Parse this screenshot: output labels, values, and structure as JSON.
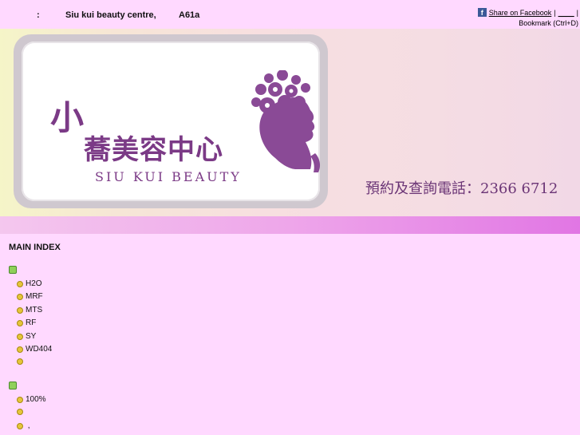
{
  "topbar": {
    "colon": ":",
    "business_name": "Siu kui beauty centre,",
    "code": "A61a",
    "facebook_icon": "f",
    "share_label": "Share on Facebook",
    "separator": "|",
    "blank_link": "____",
    "separator2": "|",
    "bookmark": "Bookmark (Ctrl+D)"
  },
  "banner": {
    "logo_cn_small": "小",
    "logo_cn_main": "蕎美容中心",
    "logo_en": "SIU KUI BEAUTY",
    "phone": "預約及查詢電話：2366 6712"
  },
  "nav": {
    "heading": "MAIN INDEX",
    "group1_items": [
      "H2O",
      "MRF",
      "MTS",
      "RF",
      "SY",
      "WD404",
      ""
    ],
    "group2_items": [
      "100%",
      "",
      " ,"
    ]
  },
  "colors": {
    "page_bg": "#ffd9ff",
    "brand_purple": "#7b3a86",
    "stripe_end": "#e176e4"
  }
}
